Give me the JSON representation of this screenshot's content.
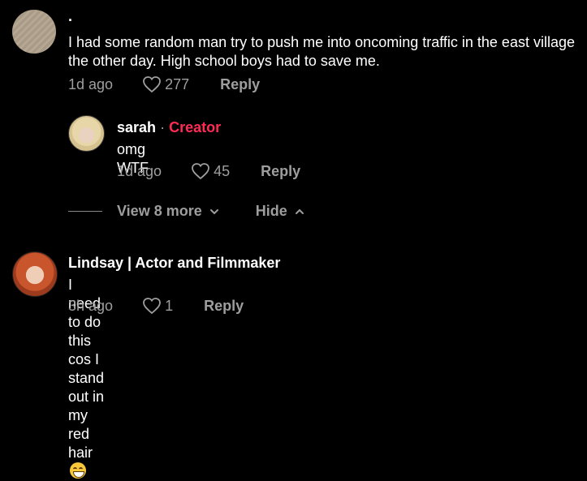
{
  "comments": [
    {
      "username": ".",
      "text": "I had some random man try to push me into oncoming traffic in the east village the other day. High school boys had to save me.",
      "time": "1d ago",
      "likes": "277",
      "reply_label": "Reply",
      "avatar": "blank-avatar"
    },
    {
      "username": "sarah",
      "separator": "·",
      "badge": "Creator",
      "text": "omg WTF",
      "time": "1d ago",
      "likes": "45",
      "reply_label": "Reply",
      "avatar": "sarah-avatar"
    },
    {
      "username": "Lindsay | Actor and Filmmaker",
      "text": "I need to do this cos I stand out in my red hair",
      "emoji": "grinning-sweat-emoji",
      "time": "3h ago",
      "likes": "1",
      "reply_label": "Reply",
      "avatar": "lindsay-avatar"
    }
  ],
  "replies_toggle": {
    "view_more_label": "View 8 more",
    "hide_label": "Hide"
  },
  "colors": {
    "background": "#000000",
    "creator_badge": "#fe2c55",
    "secondary_text": "#9e9e9e"
  }
}
